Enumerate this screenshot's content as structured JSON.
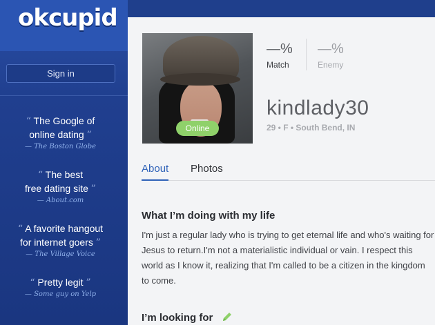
{
  "brand": {
    "logo_text": "okcupid"
  },
  "sidebar": {
    "signin_label": "Sign in",
    "quotes": [
      {
        "text_line1": "The Google of",
        "text_line2": "online dating",
        "source": "— The Boston Globe"
      },
      {
        "text_line1": "The best",
        "text_line2": "free dating site",
        "source": "— About.com"
      },
      {
        "text_line1": "A favorite hangout",
        "text_line2": "for internet goers",
        "source": "— The Village Voice"
      },
      {
        "text_line1": "Pretty legit",
        "text_line2": "",
        "source": "— Some guy on Yelp"
      }
    ]
  },
  "profile": {
    "online_label": "Online",
    "match": {
      "value": "—%",
      "label": "Match"
    },
    "enemy": {
      "value": "—%",
      "label": "Enemy"
    },
    "username": "kindlady30",
    "details": "29 • F • South Bend, IN"
  },
  "tabs": [
    {
      "label": "About",
      "active": true
    },
    {
      "label": "Photos",
      "active": false
    }
  ],
  "sections": {
    "doing_title": "What I’m doing with my life",
    "doing_body": "I'm just a regular lady who is trying to get eternal life and who's waiting for Jesus to return.I'm not a materialistic individual or vain. I respect this world as I know it, realizing that I'm called to be a citizen in the kingdom to come.",
    "looking_title": "I’m looking for"
  },
  "colors": {
    "sidebar": "#1f3f8c",
    "accent": "#2f62b8",
    "online": "#8fd16a",
    "edit_icon": "#8fd16a"
  },
  "icons": {
    "edit": "pencil-icon"
  }
}
